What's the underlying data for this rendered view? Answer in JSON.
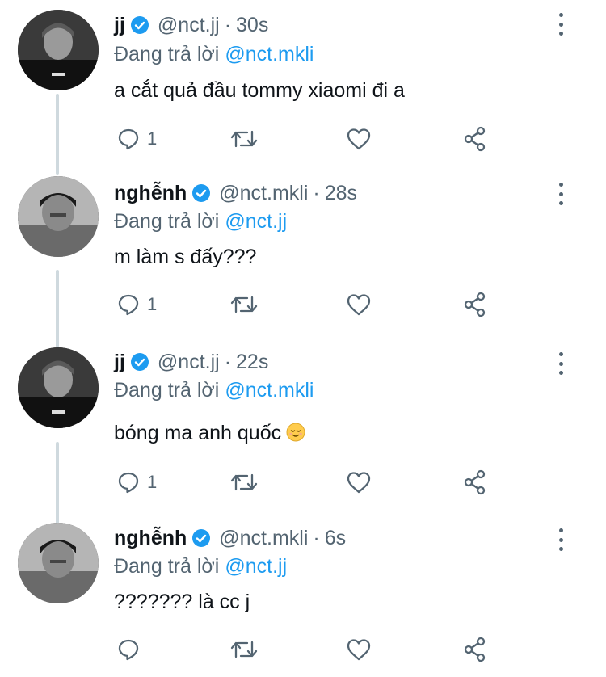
{
  "thread": {
    "reply_prefix": "Đang trả lời",
    "tweets": [
      {
        "display_name": "jj",
        "handle": "@nct.jj",
        "time": "30s",
        "reply_to": "@nct.mkli",
        "text": "a cắt quả đầu tommy xiaomi đi a",
        "reply_count": "1",
        "avatar_icon": "avatar-jj"
      },
      {
        "display_name": "nghễnh",
        "handle": "@nct.mkli",
        "time": "28s",
        "reply_to": "@nct.jj",
        "text": "m làm s đấy???",
        "reply_count": "1",
        "avatar_icon": "avatar-nghenh"
      },
      {
        "display_name": "jj",
        "handle": "@nct.jj",
        "time": "22s",
        "reply_to": "@nct.mkli",
        "text": "bóng ma anh quốc",
        "emoji": "relieved-face-icon",
        "reply_count": "1",
        "avatar_icon": "avatar-jj"
      },
      {
        "display_name": "nghễnh",
        "handle": "@nct.mkli",
        "time": "6s",
        "reply_to": "@nct.jj",
        "text": "??????? là cc j",
        "reply_count": "",
        "avatar_icon": "avatar-nghenh"
      }
    ]
  },
  "icons": {
    "verified": "verified-badge-icon",
    "reply": "reply-icon",
    "retweet": "retweet-icon",
    "like": "like-icon",
    "share": "share-icon",
    "more": "more-options-icon"
  },
  "colors": {
    "text": "#0f1419",
    "secondary": "#536471",
    "accent": "#1d9bf0",
    "thread_line": "#cfd9de"
  }
}
